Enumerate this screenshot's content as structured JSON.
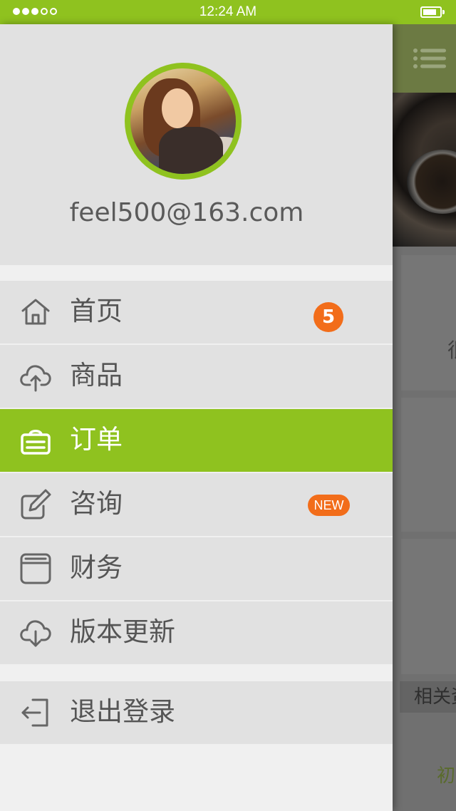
{
  "status_bar": {
    "time": "12:24 AM",
    "signal": {
      "filled": 3,
      "total": 5
    },
    "battery_level": 0.75
  },
  "drawer": {
    "email": "feel500@163.com",
    "menu": [
      {
        "label": "首页",
        "icon": "home-icon",
        "badge": "5",
        "active": false
      },
      {
        "label": "商品",
        "icon": "cloud-upload-icon",
        "active": false
      },
      {
        "label": "订单",
        "icon": "shopping-basket-icon",
        "active": true
      },
      {
        "label": "咨询",
        "icon": "edit-icon",
        "badge": "NEW",
        "active": false
      },
      {
        "label": "财务",
        "icon": "wallet-icon",
        "active": false
      },
      {
        "label": "版本更新",
        "icon": "cloud-download-icon",
        "active": false
      }
    ],
    "logout": {
      "label": "退出登录",
      "icon": "logout-icon"
    }
  },
  "background": {
    "card_char": "很",
    "related_label": "相关资",
    "early_char": "初"
  },
  "colors": {
    "accent": "#8fc21f",
    "badge": "#f26d1a",
    "drawer_bg": "#e1e1e1",
    "text": "#555555"
  }
}
